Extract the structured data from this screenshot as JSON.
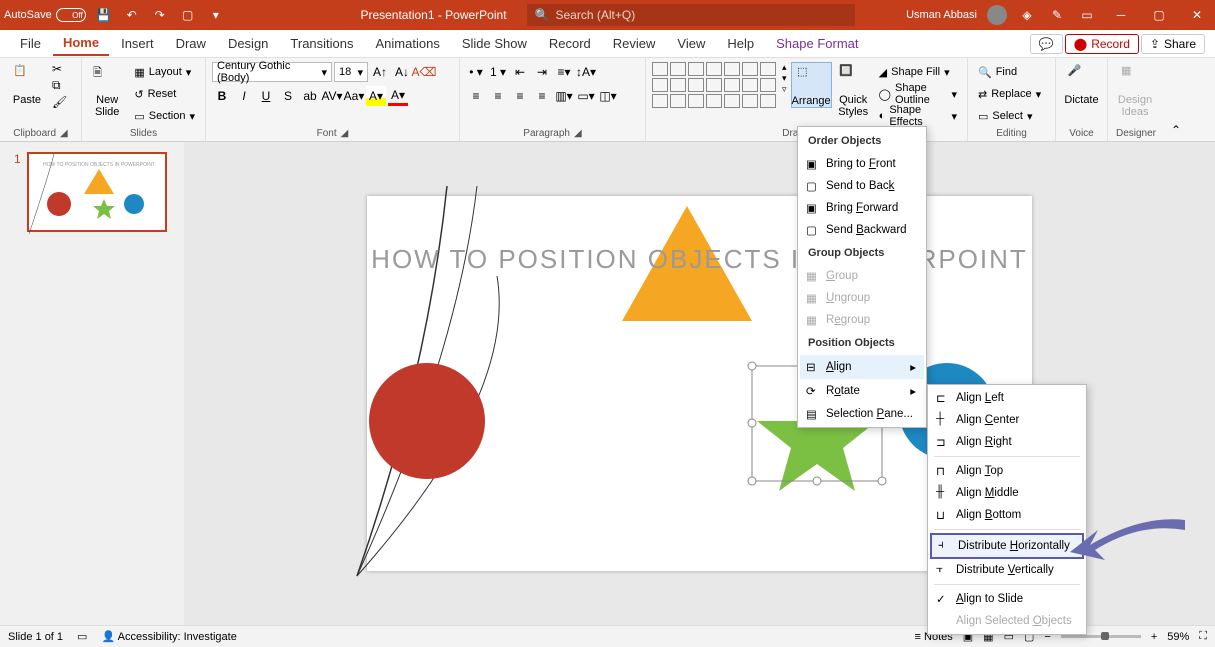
{
  "titlebar": {
    "autosave_label": "AutoSave",
    "autosave_state": "Off",
    "doc_title": "Presentation1 - PowerPoint",
    "search_placeholder": "Search (Alt+Q)",
    "user_name": "Usman Abbasi"
  },
  "tabs": {
    "items": [
      "File",
      "Home",
      "Insert",
      "Draw",
      "Design",
      "Transitions",
      "Animations",
      "Slide Show",
      "Record",
      "Review",
      "View",
      "Help",
      "Shape Format"
    ],
    "active_index": 1,
    "comments_label": "",
    "record_label": "Record",
    "share_label": "Share"
  },
  "ribbon": {
    "clipboard": {
      "paste": "Paste",
      "label": "Clipboard"
    },
    "slides": {
      "new_slide": "New\nSlide",
      "layout": "Layout",
      "reset": "Reset",
      "section": "Section",
      "label": "Slides"
    },
    "font": {
      "family": "Century Gothic (Body)",
      "size": "18",
      "label": "Font"
    },
    "paragraph": {
      "label": "Paragraph"
    },
    "drawing": {
      "arrange": "Arrange",
      "quick_styles": "Quick\nStyles",
      "shape_fill": "Shape Fill",
      "shape_outline": "Shape Outline",
      "shape_effects": "Shape Effects",
      "label": "Drawing"
    },
    "editing": {
      "find": "Find",
      "replace": "Replace",
      "select": "Select",
      "label": "Editing"
    },
    "voice": {
      "dictate": "Dictate",
      "label": "Voice"
    },
    "designer": {
      "ideas": "Design\nIdeas",
      "label": "Designer"
    }
  },
  "arrange_menu": {
    "order_header": "Order Objects",
    "bring_front": "Bring to Front",
    "send_back": "Send to Back",
    "bring_forward": "Bring Forward",
    "send_backward": "Send Backward",
    "group_header": "Group Objects",
    "group": "Group",
    "ungroup": "Ungroup",
    "regroup": "Regroup",
    "position_header": "Position Objects",
    "align": "Align",
    "rotate": "Rotate",
    "selection_pane": "Selection Pane..."
  },
  "align_menu": {
    "left": "Align Left",
    "center": "Align Center",
    "right": "Align Right",
    "top": "Align Top",
    "middle": "Align Middle",
    "bottom": "Align Bottom",
    "dist_h": "Distribute Horizontally",
    "dist_v": "Distribute Vertically",
    "to_slide": "Align to Slide",
    "selected": "Align Selected Objects"
  },
  "slide_content": {
    "title": "HOW TO POSITION OBJECTS  IN POWERPOINT"
  },
  "statusbar": {
    "slide_info": "Slide 1 of 1",
    "accessibility": "Accessibility: Investigate",
    "notes": "Notes",
    "zoom": "59%"
  },
  "colors": {
    "accent": "#c43e1c",
    "triangle": "#f5a623",
    "circle_red": "#c0392b",
    "star": "#7bc043",
    "circle_blue": "#1e88c3",
    "callout": "#6b6bb0"
  }
}
